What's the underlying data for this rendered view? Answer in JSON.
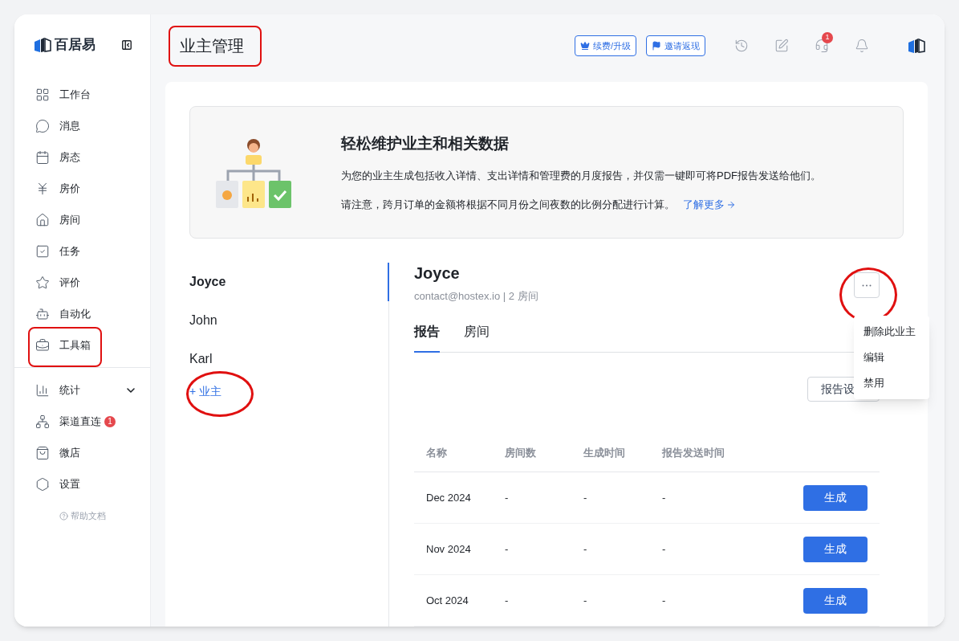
{
  "brand": {
    "name": "百居易"
  },
  "sidebar": {
    "primary_items": [
      {
        "label": "工作台"
      },
      {
        "label": "消息"
      },
      {
        "label": "房态"
      },
      {
        "label": "房价"
      },
      {
        "label": "房间"
      },
      {
        "label": "任务"
      },
      {
        "label": "评价"
      },
      {
        "label": "自动化"
      },
      {
        "label": "工具箱"
      }
    ],
    "secondary_items": [
      {
        "label": "统计",
        "expanded": false
      },
      {
        "label": "渠道直连",
        "badge": "1"
      },
      {
        "label": "微店"
      },
      {
        "label": "设置"
      }
    ],
    "help": "帮助文档"
  },
  "header": {
    "title": "业主管理",
    "buttons": [
      "续费/升级",
      "邀请返现"
    ],
    "support_badge": "1"
  },
  "banner": {
    "title": "轻松维护业主和相关数据",
    "text": "为您的业主生成包括收入详情、支出详情和管理费的月度报告，并仅需一键即可将PDF报告发送给他们。",
    "note": "请注意，跨月订单的金额将根据不同月份之间夜数的比例分配进行计算。",
    "link": "了解更多"
  },
  "owners": [
    {
      "name": "Joyce",
      "selected": true
    },
    {
      "name": "John",
      "selected": false
    },
    {
      "name": "Karl",
      "selected": false
    }
  ],
  "add_owner": "+ 业主",
  "detail": {
    "name": "Joyce",
    "meta": "contact@hostex.io | 2 房间",
    "tabs": [
      {
        "label": "报告",
        "selected": true
      },
      {
        "label": "房间",
        "selected": false
      }
    ],
    "settings_button": "报告设",
    "menu": [
      "删除此业主",
      "编辑",
      "禁用"
    ],
    "table": {
      "columns": [
        "名称",
        "房间数",
        "生成时间",
        "报告发送时间"
      ],
      "rows": [
        {
          "cells": [
            "Dec 2024",
            "-",
            "-",
            "-"
          ],
          "action": "生成"
        },
        {
          "cells": [
            "Nov 2024",
            "-",
            "-",
            "-"
          ],
          "action": "生成"
        },
        {
          "cells": [
            "Oct 2024",
            "-",
            "-",
            "-"
          ],
          "action": "生成"
        }
      ]
    }
  }
}
